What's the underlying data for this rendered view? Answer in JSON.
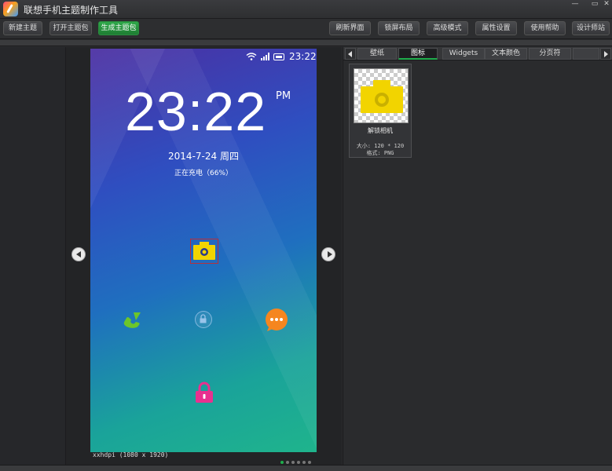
{
  "app": {
    "title": "联想手机主题制作工具"
  },
  "window": {
    "minimize": "—",
    "maximize": "▭",
    "close": "✕"
  },
  "toolbar": {
    "new_theme": "新建主题",
    "open_theme": "打开主题包",
    "generate_theme": "生成主题包",
    "refresh": "刷新界面",
    "lockscreen_layout": "锁屏布局",
    "advanced_mode": "高级模式",
    "properties": "属性设置",
    "help": "使用帮助",
    "designer": "设计师站"
  },
  "preview": {
    "status_time": "23:22",
    "clock": "23:22",
    "ampm": "PM",
    "date": "2014-7-24  周四",
    "charging": "正在充电（66%）",
    "resolution": "xxhdpi (1080 x 1920)",
    "page_count": 6,
    "active_page": 0
  },
  "tabs": [
    {
      "label": "壁纸"
    },
    {
      "label": "图标"
    },
    {
      "label": "Widgets"
    },
    {
      "label": "文本颜色"
    },
    {
      "label": "分页符"
    }
  ],
  "active_tab": 1,
  "asset": {
    "name": "解锁相机",
    "size": "大小: 120 * 120",
    "format": "格式: PNG"
  },
  "colors": {
    "accent": "#1fae4c",
    "camera_yellow": "#f2d400",
    "lock_pink": "#e8318f",
    "message_orange": "#f5861f",
    "phone_green": "#6cc52a"
  }
}
